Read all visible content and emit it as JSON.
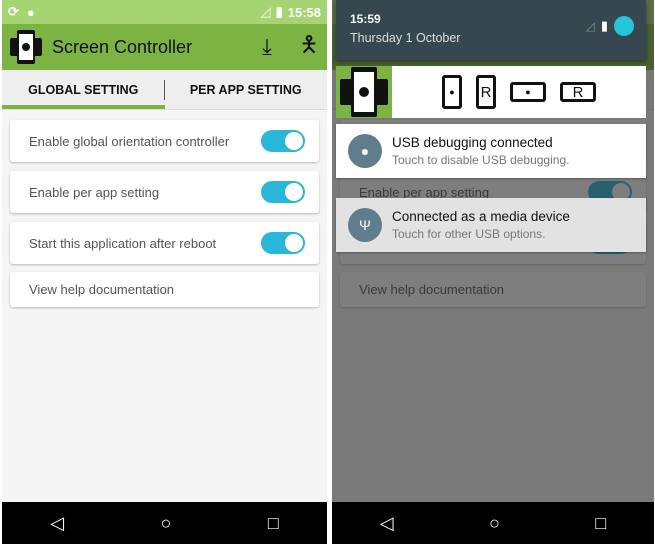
{
  "left": {
    "status_bar": {
      "time": "15:58",
      "left_icons": [
        "screen-rotation-icon",
        "android-icon"
      ],
      "right_icons": [
        "signal-icon",
        "battery-charging-icon"
      ]
    },
    "toolbar": {
      "title": "Screen Controller",
      "actions": [
        "download-icon",
        "accessibility-icon"
      ]
    },
    "tabs": [
      {
        "label": "GLOBAL SETTING",
        "selected": true
      },
      {
        "label": "PER APP SETTING",
        "selected": false
      }
    ],
    "settings": [
      {
        "label": "Enable global orientation controller",
        "toggle": true
      },
      {
        "label": "Enable per app setting",
        "toggle": true
      },
      {
        "label": "Start this application after reboot",
        "toggle": true
      },
      {
        "label": "View help documentation"
      }
    ]
  },
  "right": {
    "shade": {
      "time": "15:59",
      "date": "Thursday 1 October"
    },
    "widget": {
      "options": [
        "android-portrait",
        "R",
        "android-landscape",
        "R"
      ]
    },
    "notifications": [
      {
        "title": "USB debugging connected",
        "subtitle": "Touch to disable USB debugging.",
        "icon": "android-icon"
      },
      {
        "title": "Connected as a media device",
        "subtitle": "Touch for other USB options.",
        "icon": "usb-icon"
      }
    ]
  },
  "nav": {
    "back": "◁",
    "home": "○",
    "recents": "□"
  },
  "colors": {
    "primary": "#7cb342",
    "status": "#a6d473",
    "toggle": "#29b6d8",
    "shade": "#37474f"
  }
}
